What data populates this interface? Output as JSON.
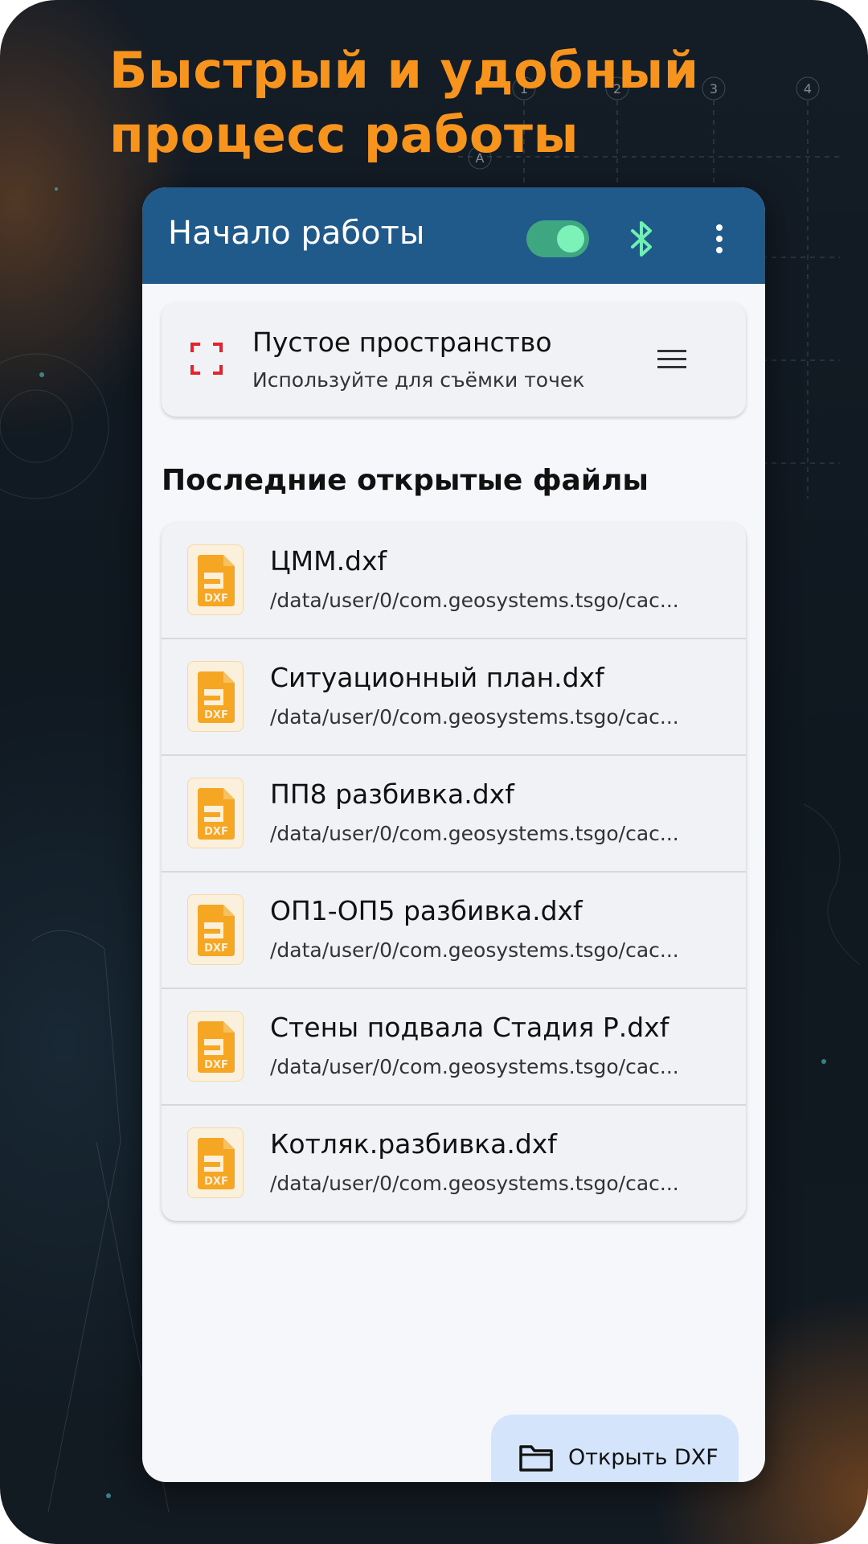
{
  "headline": {
    "line1": "Быстрый и удобный",
    "line2": "процесс работы"
  },
  "background": {
    "grid_axis_labels": [
      "1",
      "2",
      "3",
      "4",
      "A"
    ]
  },
  "appbar": {
    "title": "Начало работы",
    "toggle_state": "on",
    "bluetooth_icon": "bluetooth-icon",
    "more_icon": "more-vert-icon"
  },
  "empty_space_card": {
    "title": "Пустое пространство",
    "subtitle": "Используйте для съёмки точек",
    "icon": "focus-frame-icon",
    "menu_icon": "menu-icon"
  },
  "recent": {
    "section_title": "Последние открытые файлы",
    "files": [
      {
        "name": "ЦММ.dxf",
        "path": "/data/user/0/com.geosystems.tsgo/cac..."
      },
      {
        "name": "Ситуационный план.dxf",
        "path": "/data/user/0/com.geosystems.tsgo/cac..."
      },
      {
        "name": "ПП8 разбивка.dxf",
        "path": "/data/user/0/com.geosystems.tsgo/cac..."
      },
      {
        "name": "ОП1-ОП5 разбивка.dxf",
        "path": "/data/user/0/com.geosystems.tsgo/cac..."
      },
      {
        "name": "Стены подвала Стадия Р.dxf",
        "path": "/data/user/0/com.geosystems.tsgo/cac..."
      },
      {
        "name": "Котляк.разбивка.dxf",
        "path": "/data/user/0/com.geosystems.tsgo/cac..."
      }
    ],
    "file_icon_badge": "DXF"
  },
  "fab": {
    "label": "Открыть DXF",
    "icon": "folder-icon"
  },
  "colors": {
    "accent_orange": "#f7941d",
    "appbar_blue": "#1f5a8b",
    "toggle_green": "#3ea681",
    "bluetooth_green": "#6ef0b0",
    "dxf_yellow": "#f5a623",
    "fab_blue": "#d3e4fb"
  }
}
